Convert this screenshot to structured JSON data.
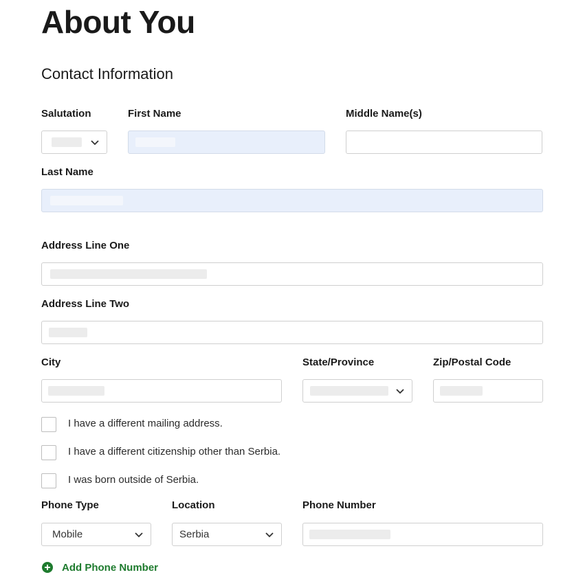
{
  "page": {
    "title": "About You",
    "section_title": "Contact Information"
  },
  "labels": {
    "salutation": "Salutation",
    "first_name": "First Name",
    "middle_name": "Middle Name(s)",
    "last_name": "Last Name",
    "address_one": "Address Line One",
    "address_two": "Address Line Two",
    "city": "City",
    "state": "State/Province",
    "zip": "Zip/Postal Code",
    "phone_type": "Phone Type",
    "location": "Location",
    "phone_number": "Phone Number"
  },
  "checkboxes": [
    {
      "label": "I have a different mailing address.",
      "checked": false
    },
    {
      "label": "I have a different citizenship other than Serbia.",
      "checked": false
    },
    {
      "label": "I was born outside of Serbia.",
      "checked": false
    }
  ],
  "selects": {
    "phone_type": "Mobile",
    "location": "Serbia"
  },
  "actions": {
    "add_phone": "Add Phone Number"
  },
  "icons": {
    "select_arrow": "chevron-down-icon",
    "add": "plus-circle-icon"
  },
  "colors": {
    "accent": "#1e7b2e",
    "autofill_bg": "#e8effb",
    "border": "#cfcfcf"
  }
}
